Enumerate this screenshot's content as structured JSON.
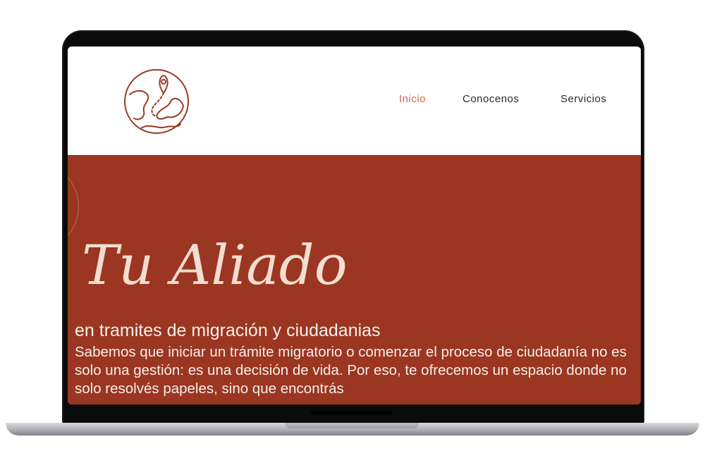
{
  "nav": {
    "items": [
      {
        "label": "Inicio",
        "active": true
      },
      {
        "label": "Conocenos",
        "active": false
      },
      {
        "label": "Servicios",
        "active": false
      }
    ]
  },
  "hero": {
    "title": "Tu Aliado",
    "subtitle": "en tramites de migración y ciudadanias",
    "body": "Sabemos que iniciar un trámite migratorio o comenzar el proceso de ciudadanía no es solo una gestión: es una decisión de vida. Por eso, te ofrecemos un espacio donde no solo resolvés papeles, sino que encontrás"
  },
  "logo": {
    "icon": "globe-location-pin-icon"
  },
  "colors": {
    "brand": "#9a3621",
    "accent_nav_active": "#d4694a",
    "hero_title": "#f3ddd0",
    "hero_text": "#f7efe9"
  }
}
